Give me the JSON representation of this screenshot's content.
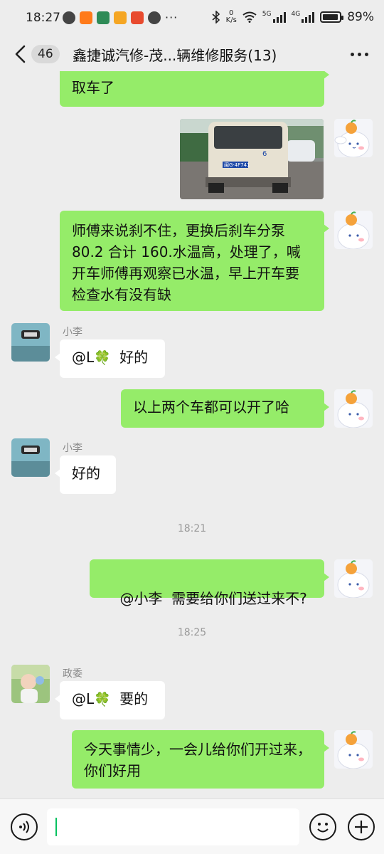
{
  "status_bar": {
    "time": "18:27",
    "net_speed_value": "0",
    "net_speed_unit": "K/s",
    "signal_1": "5G",
    "signal_2": "4G",
    "battery": "89%"
  },
  "nav": {
    "back_count": "46",
    "title": "鑫捷诚汽修-茂...辆维修服务(13)"
  },
  "messages": [
    {
      "id": "m1",
      "side": "right",
      "text": "取车了"
    },
    {
      "id": "m2",
      "side": "right",
      "type": "image",
      "plate_text": "闽G·4F741",
      "van_label": "6"
    },
    {
      "id": "m3",
      "side": "right",
      "text": "师傅来说刹不住，更换后刹车分泵80.2 合计 160.水温高，处理了，喊开车师傅再观察已水温，早上开车要检查水有没有缺"
    },
    {
      "id": "m4",
      "side": "left",
      "sender": "小李",
      "mention": "@L",
      "text": "好的"
    },
    {
      "id": "m5",
      "side": "right",
      "text": "以上两个车都可以开了哈"
    },
    {
      "id": "m6",
      "side": "left",
      "sender": "小李",
      "text": "好的"
    },
    {
      "id": "t1",
      "type": "time",
      "text": "18:21"
    },
    {
      "id": "m7",
      "side": "right",
      "text": "@小李  需要给你们送过来不?"
    },
    {
      "id": "t2",
      "type": "time",
      "text": "18:25"
    },
    {
      "id": "m8",
      "side": "left",
      "sender": "政委",
      "mention": "@L",
      "text": "要的"
    },
    {
      "id": "m9",
      "side": "right",
      "text": "今天事情少，一会儿给你们开过来，你们好用"
    }
  ],
  "input_bar": {
    "voice_icon": "voice-icon",
    "emoji_icon": "emoji-icon",
    "plus_icon": "plus-icon",
    "input_value": ""
  },
  "colors": {
    "background": "#ededed",
    "bubble_self": "#95ec69",
    "bubble_other": "#ffffff",
    "cursor": "#07c160"
  }
}
